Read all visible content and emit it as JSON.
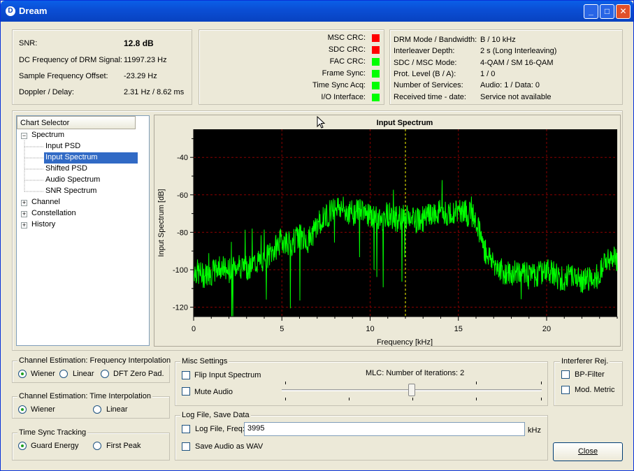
{
  "window": {
    "title": "Dream"
  },
  "status": {
    "snr_label": "SNR:",
    "snr_value": "12.8 dB",
    "dc_label": "DC Frequency of DRM Signal:",
    "dc_value": "11997.23 Hz",
    "sfo_label": "Sample Frequency Offset:",
    "sfo_value": "-23.29 Hz",
    "doppler_label": "Doppler / Delay:",
    "doppler_value": "2.31 Hz / 8.62 ms"
  },
  "crc": [
    {
      "label": "MSC CRC:",
      "color": "#ff0000"
    },
    {
      "label": "SDC CRC:",
      "color": "#ff0000"
    },
    {
      "label": "FAC CRC:",
      "color": "#00ff00"
    },
    {
      "label": "Frame Sync:",
      "color": "#00ff00"
    },
    {
      "label": "Time Sync Acq:",
      "color": "#00ff00"
    },
    {
      "label": "I/O Interface:",
      "color": "#00ff00"
    }
  ],
  "mode": [
    {
      "label": "DRM Mode / Bandwidth:",
      "value": "B / 10 kHz"
    },
    {
      "label": "Interleaver Depth:",
      "value": "2 s (Long Interleaving)"
    },
    {
      "label": "SDC / MSC Mode:",
      "value": "4-QAM / SM 16-QAM"
    },
    {
      "label": "Prot. Level (B / A):",
      "value": "1 / 0"
    },
    {
      "label": "Number of Services:",
      "value": "Audio: 1 / Data: 0"
    },
    {
      "label": "Received time - date:",
      "value": "Service not available"
    }
  ],
  "tree": {
    "header": "Chart Selector",
    "spectrum": "Spectrum",
    "items": [
      "Input PSD",
      "Input Spectrum",
      "Shifted PSD",
      "Audio Spectrum",
      "SNR Spectrum"
    ],
    "channel": "Channel",
    "constellation": "Constellation",
    "history": "History"
  },
  "chart_data": {
    "type": "line",
    "title": "Input Spectrum",
    "xlabel": "Frequency [kHz]",
    "ylabel": "Input Spectrum [dB]",
    "xlim": [
      0,
      24
    ],
    "ylim": [
      -125,
      -25
    ],
    "xticks": [
      "0",
      "5",
      "10",
      "15",
      "20"
    ],
    "yticks": [
      "-40",
      "-60",
      "-80",
      "-100",
      "-120"
    ],
    "dc_marker_khz": 12,
    "grid": true,
    "series": [
      {
        "color": "#00ff00",
        "x": [
          0,
          0.5,
          1,
          1.5,
          2,
          2.5,
          3,
          3.5,
          4,
          4.5,
          5,
          5.5,
          6,
          6.5,
          7,
          7.5,
          8,
          8.5,
          9,
          9.5,
          10,
          10.5,
          11,
          11.5,
          12,
          12.5,
          13,
          13.5,
          14,
          14.5,
          15,
          15.5,
          16,
          16.5,
          17,
          17.5,
          18,
          18.5,
          19,
          19.5,
          20,
          20.5,
          21,
          21.5,
          22,
          22.5,
          23,
          23.5,
          24
        ],
        "y": [
          -100,
          -103,
          -102,
          -98,
          -101,
          -97,
          -99,
          -96,
          -95,
          -90,
          -84,
          -86,
          -82,
          -85,
          -76,
          -72,
          -65,
          -68,
          -70,
          -67,
          -71,
          -74,
          -70,
          -73,
          -72,
          -74,
          -73,
          -71,
          -69,
          -71,
          -68,
          -70,
          -72,
          -90,
          -96,
          -101,
          -103,
          -100,
          -104,
          -102,
          -100,
          -103,
          -105,
          -102,
          -106,
          -104,
          -103,
          -93,
          -95
        ]
      }
    ]
  },
  "freq_interp": {
    "title": "Channel Estimation: Frequency Interpolation",
    "options": [
      "Wiener",
      "Linear",
      "DFT Zero Pad."
    ]
  },
  "time_interp": {
    "title": "Channel Estimation: Time Interpolation",
    "options": [
      "Wiener",
      "Linear"
    ]
  },
  "time_sync": {
    "title": "Time Sync Tracking",
    "options": [
      "Guard Energy",
      "First Peak"
    ]
  },
  "misc": {
    "title": "Misc Settings",
    "flip": "Flip Input Spectrum",
    "mute": "Mute Audio",
    "mlc": "MLC: Number of Iterations: 2"
  },
  "mlc_level": 0.5,
  "logfile": {
    "title": "Log File, Save Data",
    "freq_label": "Log File, Freq:",
    "freq_value": "3995",
    "unit": "kHz",
    "wav": "Save Audio as WAV"
  },
  "interferer": {
    "title": "Interferer Rej.",
    "bp": "BP-Filter",
    "mod": "Mod. Metric"
  },
  "close_label": "Close"
}
